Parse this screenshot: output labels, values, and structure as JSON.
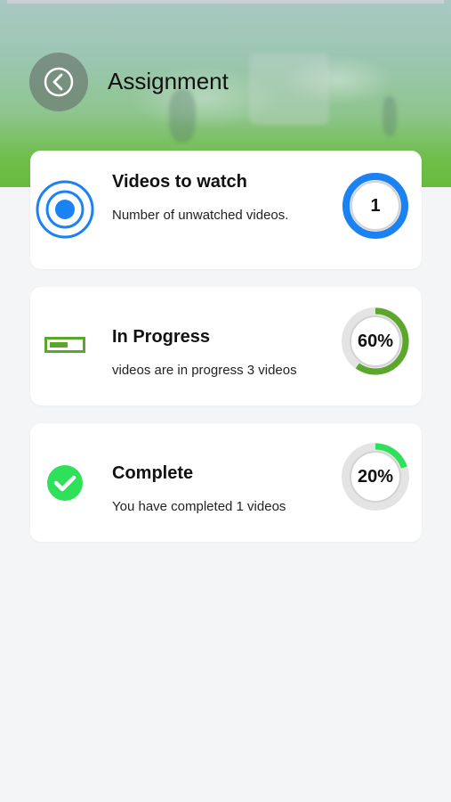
{
  "header": {
    "title": "Assignment",
    "back_icon": "chevron-left-circle-icon"
  },
  "cards": [
    {
      "title": "Videos to watch",
      "subtitle": "Number of unwatched videos.",
      "icon": "target-circle-icon",
      "value_label": "1",
      "progress": 1.0,
      "ring_color": "#1a82f2"
    },
    {
      "title": "In Progress",
      "subtitle": " videos are in progress 3 videos",
      "icon": "progress-bar-icon",
      "value_label": "60%",
      "progress": 0.6,
      "ring_color": "#5aa72c"
    },
    {
      "title": "Complete",
      "subtitle": "You have completed  1 videos",
      "icon": "check-circle-icon",
      "value_label": "20%",
      "progress": 0.2,
      "ring_color": "#2fe05a"
    }
  ],
  "colors": {
    "primary_blue": "#1a82f2",
    "progress_green": "#5aa72c",
    "complete_green": "#2fe05a",
    "background": "#f4f5f7"
  }
}
